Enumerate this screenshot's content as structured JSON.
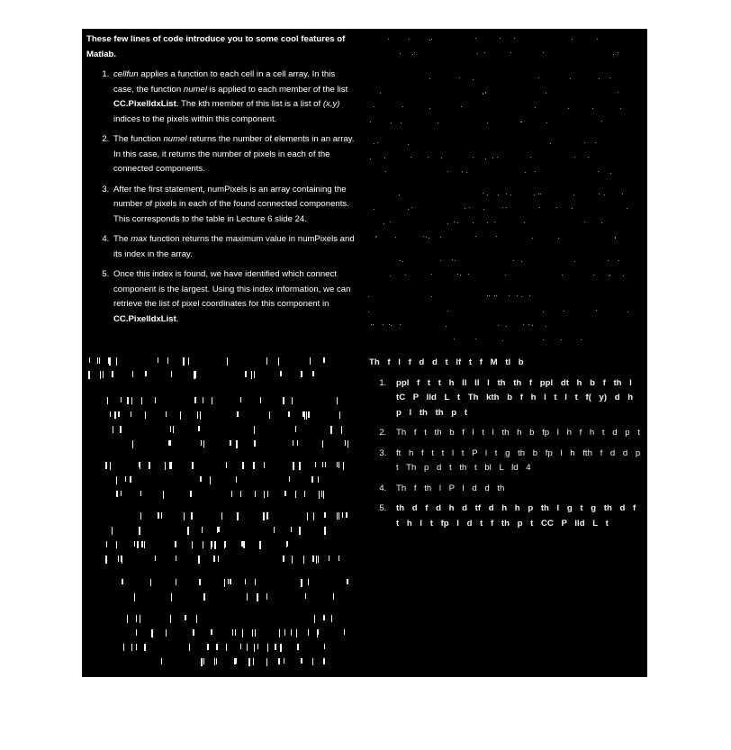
{
  "colors": {
    "background": "#000000",
    "text": "#ffffff",
    "page": "#ffffff"
  },
  "top_left": {
    "intro": "These few lines of code introduce you to some cool features of Matlab.",
    "items": [
      {
        "parts": [
          {
            "t": "cellfun",
            "s": "ital"
          },
          {
            "t": " applies a function to each cell in a cell array. In this case, the function ",
            "s": ""
          },
          {
            "t": "numel",
            "s": "ital"
          },
          {
            "t": " is applied to each member of the list ",
            "s": ""
          },
          {
            "t": "CC.PixelIdxList",
            "s": "bold"
          },
          {
            "t": ". The kth member of this list is a list of ",
            "s": ""
          },
          {
            "t": "(x,y)",
            "s": "ital"
          },
          {
            "t": " indices to the pixels within this component.",
            "s": ""
          }
        ]
      },
      {
        "parts": [
          {
            "t": "The function ",
            "s": ""
          },
          {
            "t": "numel",
            "s": "ital"
          },
          {
            "t": " returns the number of elements in an array. In this case, it returns the number of pixels in each of the connected components.",
            "s": ""
          }
        ]
      },
      {
        "parts": [
          {
            "t": "After the first statement, numPixels is an array containing the number of pixels in each of the found connected components. This corresponds to the table in Lecture 6 slide 24.",
            "s": ""
          }
        ]
      },
      {
        "parts": [
          {
            "t": "The ",
            "s": ""
          },
          {
            "t": "max",
            "s": "ital"
          },
          {
            "t": " function returns the maximum value in numPixels and its index in the array.",
            "s": ""
          }
        ]
      },
      {
        "parts": [
          {
            "t": "Once this index is found, we have identified which connect component is the largest. Using this index information, we can retrieve the list of pixel coordinates for this component in ",
            "s": ""
          },
          {
            "t": "CC.PixelIdxList",
            "s": "bold"
          },
          {
            "t": ".",
            "s": ""
          }
        ]
      }
    ]
  },
  "bottom_right": {
    "intro": "Th    f l    f  d     d          t              lf  t      f M tl b",
    "items": [
      {
        "parts": [
          {
            "t": "ppl    f   t   t      h  ll       ll     l th         th f               ppl dt     h     b f th l tC  P   lld L t Th kth       b     f h l t l t f( y)  d       h p l   th  th        p    t",
            "s": "bold"
          }
        ]
      },
      {
        "parts": [
          {
            "t": "Th  f     t                th      b  f l    t l th                    h     b  fp l       h f h          t d     p     t",
            "s": ""
          }
        ]
      },
      {
        "parts": [
          {
            "t": "ft   h  f  t t l    t    P l     t    g th       b   fp l        h fth f    d  d     p      t  Th        p  d t  th t bl L          ld   4",
            "s": ""
          }
        ]
      },
      {
        "parts": [
          {
            "t": "Th     f                   th                 l P l    d      d       th",
            "s": ""
          }
        ]
      },
      {
        "parts": [
          {
            "t": "th    d     f  d     h    d  tf d h h   p          th l g t       g th    d f    t                        h l t fp l     d   t f  th      p     t  CC P   lld L t",
            "s": "bold"
          }
        ]
      }
    ]
  }
}
